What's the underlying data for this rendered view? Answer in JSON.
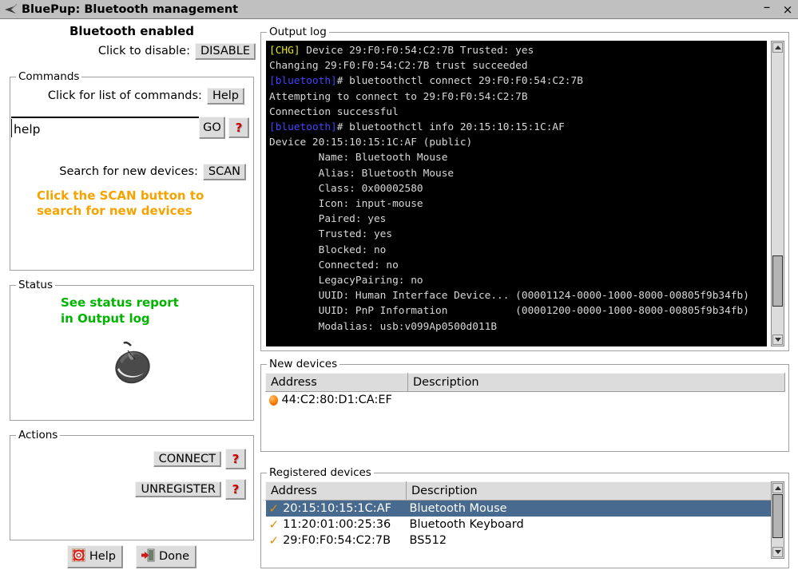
{
  "window": {
    "title": "BluePup: Bluetooth management",
    "icon": "bluetooth-app-icon",
    "minimize_label": "–",
    "close_label": "×"
  },
  "left": {
    "bluetooth_state": "Bluetooth enabled",
    "disable_label": "Click to disable:",
    "disable_button": "DISABLE",
    "commands": {
      "legend": "Commands",
      "help_label": "Click for list of commands:",
      "help_button": "Help",
      "entry_value": "help",
      "entry_placeholder": "",
      "go_button": "GO",
      "help_icon": "?",
      "scan_label": "Search for new devices:",
      "scan_button": "SCAN",
      "scan_hint_line1": "Click the SCAN button to",
      "scan_hint_line2": "search for new devices",
      "scan_hint_color": "#f5a300"
    },
    "status": {
      "legend": "Status",
      "message_line1": "See status report",
      "message_line2": "in Output log",
      "message_color": "#00b400",
      "device_icon": "computer-mouse-icon"
    },
    "actions": {
      "legend": "Actions",
      "connect_button": "CONNECT",
      "connect_help_icon": "?",
      "unregister_button": "UNREGISTER",
      "unregister_help_icon": "?"
    },
    "footer": {
      "help_button": "Help",
      "help_icon": "lifebuoy-icon",
      "done_button": "Done",
      "done_icon": "exit-door-icon"
    }
  },
  "right": {
    "output_log": {
      "legend": "Output log",
      "background": "#000000",
      "lines": [
        {
          "prefix": "[CHG]",
          "prefix_color": "#e8e800",
          "text": " Device 29:F0:F0:54:C2:7B Trusted: yes"
        },
        {
          "prefix": "",
          "prefix_color": "",
          "text": "Changing 29:F0:F0:54:C2:7B trust succeeded"
        },
        {
          "prefix": "[bluetooth]",
          "prefix_color": "#4444ff",
          "text": "# bluetoothctl connect 29:F0:F0:54:C2:7B"
        },
        {
          "prefix": "",
          "prefix_color": "",
          "text": "Attempting to connect to 29:F0:F0:54:C2:7B"
        },
        {
          "prefix": "",
          "prefix_color": "",
          "text": "Connection successful"
        },
        {
          "prefix": "[bluetooth]",
          "prefix_color": "#4444ff",
          "text": "# bluetoothctl info 20:15:10:15:1C:AF"
        },
        {
          "prefix": "",
          "prefix_color": "",
          "text": "Device 20:15:10:15:1C:AF (public)"
        },
        {
          "prefix": "",
          "prefix_color": "",
          "text": "        Name: Bluetooth Mouse"
        },
        {
          "prefix": "",
          "prefix_color": "",
          "text": "        Alias: Bluetooth Mouse"
        },
        {
          "prefix": "",
          "prefix_color": "",
          "text": "        Class: 0x00002580"
        },
        {
          "prefix": "",
          "prefix_color": "",
          "text": "        Icon: input-mouse"
        },
        {
          "prefix": "",
          "prefix_color": "",
          "text": "        Paired: yes"
        },
        {
          "prefix": "",
          "prefix_color": "",
          "text": "        Trusted: yes"
        },
        {
          "prefix": "",
          "prefix_color": "",
          "text": "        Blocked: no"
        },
        {
          "prefix": "",
          "prefix_color": "",
          "text": "        Connected: no"
        },
        {
          "prefix": "",
          "prefix_color": "",
          "text": "        LegacyPairing: no"
        },
        {
          "prefix": "",
          "prefix_color": "",
          "text": "        UUID: Human Interface Device... (00001124-0000-1000-8000-00805f9b34fb)"
        },
        {
          "prefix": "",
          "prefix_color": "",
          "text": "        UUID: PnP Information           (00001200-0000-1000-8000-00805f9b34fb)"
        },
        {
          "prefix": "",
          "prefix_color": "",
          "text": "        Modalias: usb:v099Ap0500d011B"
        }
      ],
      "scrollbar": {
        "position_percent": 88
      }
    },
    "new_devices": {
      "legend": "New devices",
      "columns": [
        "Address",
        "Description"
      ],
      "rows": [
        {
          "icon": "orange-ball-icon",
          "address": "44:C2:80:D1:CA:EF",
          "description": ""
        }
      ]
    },
    "registered_devices": {
      "legend": "Registered devices",
      "columns": [
        "Address",
        "Description"
      ],
      "rows": [
        {
          "icon": "check-icon",
          "address": "20:15:10:15:1C:AF",
          "description": "Bluetooth Mouse",
          "selected": true
        },
        {
          "icon": "check-icon",
          "address": "11:20:01:00:25:36",
          "description": "Bluetooth Keyboard",
          "selected": false
        },
        {
          "icon": "check-icon",
          "address": "29:F0:F0:54:C2:7B",
          "description": "BS512",
          "selected": false
        }
      ],
      "scrollbar": {
        "position_percent": 0
      }
    }
  }
}
